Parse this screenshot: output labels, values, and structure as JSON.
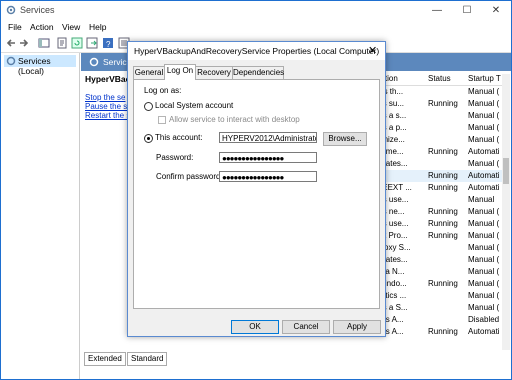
{
  "window": {
    "title": "Services"
  },
  "menu": [
    "File",
    "Action",
    "View",
    "Help"
  ],
  "tree": {
    "item": "Services (Local)"
  },
  "main": {
    "header": "Services",
    "desc_title": "HyperVBack",
    "links": [
      "Stop the se",
      "Pause the se",
      "Restart the se"
    ]
  },
  "list": {
    "columns": [
      "scription",
      "Status",
      "Startup T"
    ],
    "rows": [
      {
        "d": "nitors th...",
        "s": "",
        "t": "Manual ("
      },
      {
        "d": "vides su...",
        "s": "Running",
        "t": "Manual ("
      },
      {
        "d": "vides a s...",
        "s": "",
        "t": "Manual ("
      },
      {
        "d": "vides a p...",
        "s": "",
        "t": "Manual ("
      },
      {
        "d": "chronize...",
        "s": "",
        "t": "Manual ("
      },
      {
        "d": "nageme...",
        "s": "Running",
        "t": "Automati"
      },
      {
        "d": "ordinates...",
        "s": "",
        "t": "Manual ("
      },
      {
        "d": "",
        "s": "Running",
        "t": "Automati",
        "sel": true
      },
      {
        "d": "e IKEEXT ...",
        "s": "Running",
        "t": "Automati"
      },
      {
        "d": "vides use...",
        "s": "",
        "t": "Manual"
      },
      {
        "d": "vides ne...",
        "s": "Running",
        "t": "Manual ("
      },
      {
        "d": "vides use...",
        "s": "Running",
        "t": "Manual ("
      },
      {
        "d": "ernet Pro...",
        "s": "Running",
        "t": "Manual ("
      },
      {
        "d": "C Proxy S...",
        "s": "",
        "t": "Manual ("
      },
      {
        "d": "ordinates...",
        "s": "",
        "t": "Manual ("
      },
      {
        "d": "ates a N...",
        "s": "",
        "t": "Manual ("
      },
      {
        "d": "re Windo...",
        "s": "Running",
        "t": "Manual ("
      },
      {
        "d": "gnostics ...",
        "s": "",
        "t": "Manual ("
      },
      {
        "d": "vides a S...",
        "s": "",
        "t": "Manual ("
      },
      {
        "d": "nages A...",
        "s": "",
        "t": "Disabled"
      },
      {
        "d": "nages A...",
        "s": "Running",
        "t": "Automati"
      }
    ]
  },
  "bottom_tabs": [
    "Extended",
    "Standard"
  ],
  "dialog": {
    "title": "HyperVBackupAndRecoveryService Properties (Local Computer)",
    "close": "✕",
    "tabs": [
      "General",
      "Log On",
      "Recovery",
      "Dependencies"
    ],
    "logon_as": "Log on as:",
    "local_system": "Local System account",
    "allow_interact": "Allow service to interact with desktop",
    "this_account": "This account:",
    "account_value": "HYPERV2012\\Administrator",
    "browse": "Browse...",
    "password_label": "Password:",
    "password_value": "●●●●●●●●●●●●●●●●",
    "confirm_label": "Confirm password:",
    "confirm_value": "●●●●●●●●●●●●●●●●",
    "ok": "OK",
    "cancel": "Cancel",
    "apply": "Apply"
  },
  "colors": {
    "accent": "#1e6fd0",
    "header": "#5c88bd",
    "link": "#0033cc"
  }
}
